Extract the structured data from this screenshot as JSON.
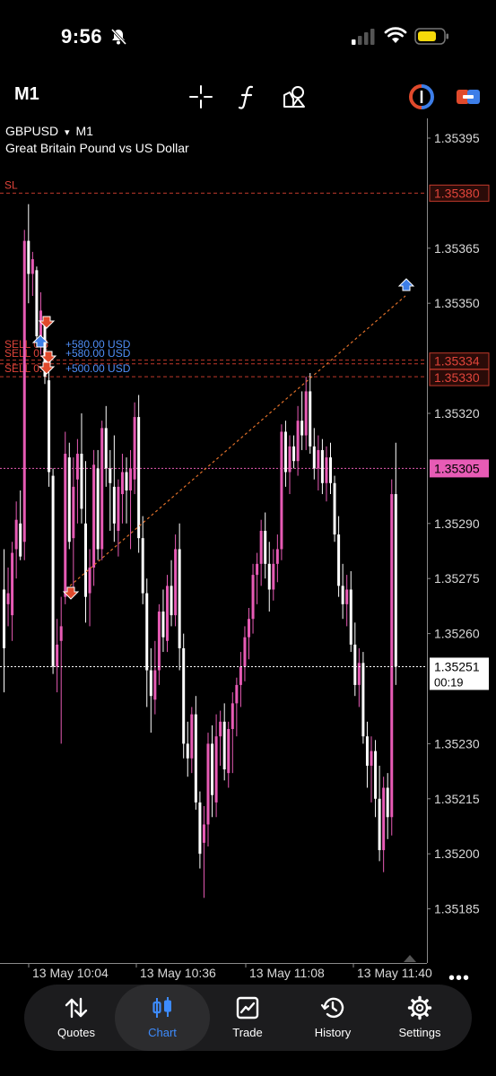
{
  "status_bar": {
    "time": "9:56",
    "icons": [
      "bell-slash-icon",
      "cellular-signal-icon",
      "wifi-icon",
      "battery-low-icon"
    ],
    "battery_color": "#f5d90a"
  },
  "toolbar": {
    "timeframe": "M1",
    "tools": [
      "crosshair-icon",
      "indicators-icon",
      "objects-icon",
      "one-click-trading-icon",
      "pair-switch-icon"
    ]
  },
  "chart": {
    "symbol": "GBPUSD",
    "symbol_arrow": "▾",
    "timeframe": "M1",
    "description": "Great Britain Pound vs US Dollar",
    "price_ticks": [
      "1.35395",
      "1.35365",
      "1.35350",
      "1.35320",
      "1.35290",
      "1.35275",
      "1.35260",
      "1.35230",
      "1.35215",
      "1.35200",
      "1.35185"
    ],
    "time_ticks": [
      "13 May 10:04",
      "13 May 10:36",
      "13 May 11:08",
      "13 May 11:40"
    ],
    "sl_label": "SL",
    "sl_price": "1.35380",
    "order_prices": [
      "1.35334",
      "1.35330"
    ],
    "orders": [
      {
        "side": "SELL",
        "volume": "0.5",
        "profit": "+580.00 USD"
      },
      {
        "side": "SELL",
        "volume": "0.5",
        "profit": "+580.00 USD"
      },
      {
        "side": "SELL",
        "volume": "0.5",
        "profit": "+500.00 USD"
      }
    ],
    "ask_price": "1.35305",
    "bid_price": "1.35251",
    "countdown": "00:19",
    "more": "•••",
    "colors": {
      "bull": "#e75bb5",
      "bear": "#ffffff",
      "sl_line": "#c0392b",
      "ask": "#e75bb5",
      "bid": "#ffffff",
      "buy_arrow": "#3d7ee8",
      "sell_arrow": "#e04a2c"
    }
  },
  "nav": [
    {
      "label": "Quotes",
      "icon": "quotes-arrows-icon",
      "active": false
    },
    {
      "label": "Chart",
      "icon": "candlestick-icon",
      "active": true
    },
    {
      "label": "Trade",
      "icon": "trade-chart-icon",
      "active": false
    },
    {
      "label": "History",
      "icon": "history-clock-icon",
      "active": false
    },
    {
      "label": "Settings",
      "icon": "gear-icon",
      "active": false
    }
  ]
}
